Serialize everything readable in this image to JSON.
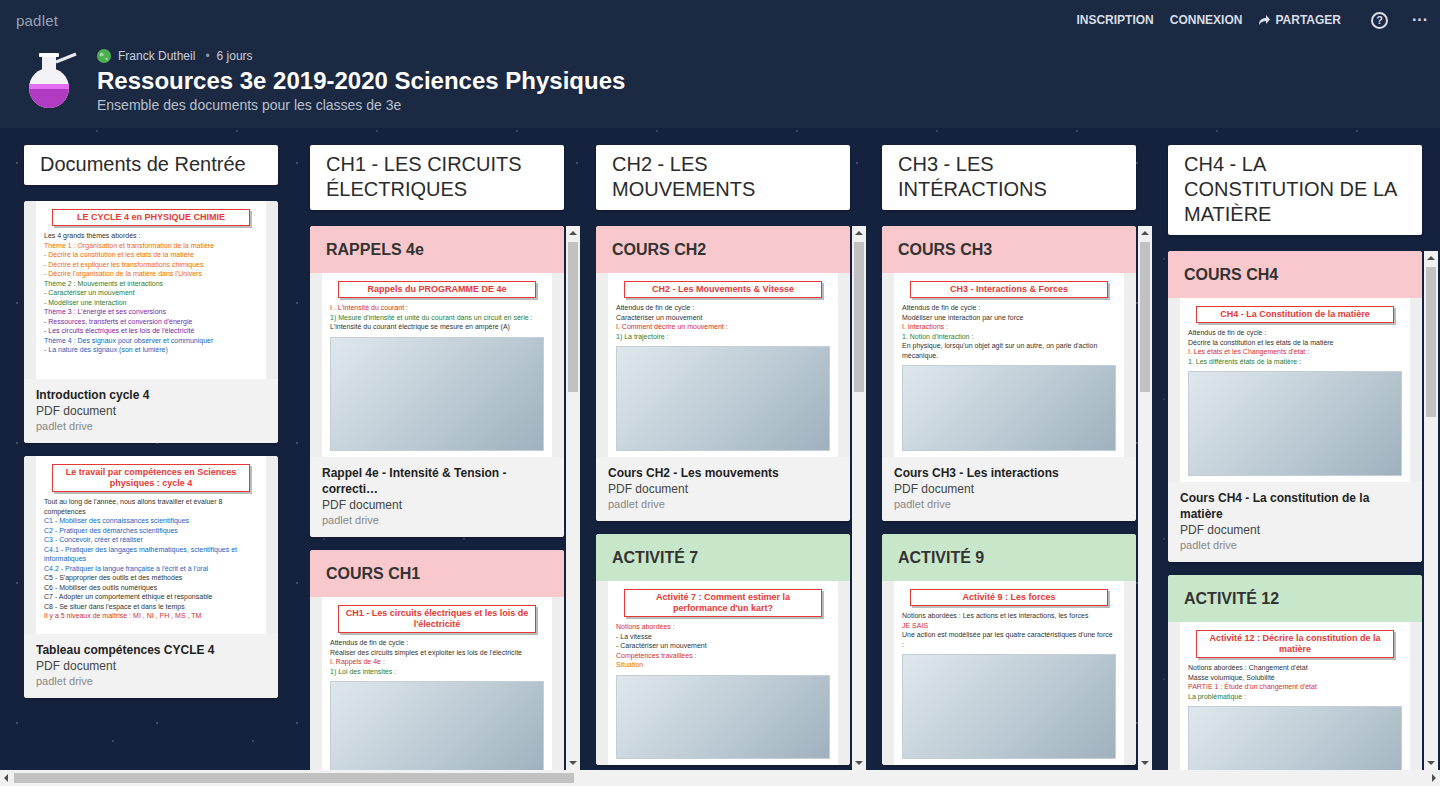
{
  "brand": "padlet",
  "nav": [
    "INSCRIPTION",
    "CONNEXION"
  ],
  "share": "PARTAGER",
  "help": "?",
  "more": "···",
  "board": {
    "author": "Franck Dutheil",
    "separator": "•",
    "age": "6 jours",
    "title": "Ressources 3e 2019-2020 Sciences Physiques",
    "subtitle": "Ensemble des documents pour les classes de 3e"
  },
  "columns": [
    {
      "title": "Documents de Rentrée",
      "scrollable": false,
      "cards": [
        {
          "thumb": {
            "title": "LE CYCLE 4 en PHYSIQUE CHIMIE",
            "figure": false,
            "lines": [
              {
                "text": "Les 4 grands thèmes abordés :",
                "color": "#333333"
              },
              {
                "text": "Thème 1 : Organisation et transformation de la matière",
                "color": "#ef6c00"
              },
              {
                "text": "- Décrire la constitution et les états de la matière",
                "color": "#ef6c00"
              },
              {
                "text": "- Décrire et expliquer les transformations chimiques",
                "color": "#ef6c00"
              },
              {
                "text": "- Décrire l'organisation de la matière dans l'Univers",
                "color": "#ef6c00"
              },
              {
                "text": "Thème 2 : Mouvements et interactions",
                "color": "#2e7d32"
              },
              {
                "text": "- Caractériser un mouvement",
                "color": "#2e7d32"
              },
              {
                "text": "- Modéliser une interaction",
                "color": "#2e7d32"
              },
              {
                "text": "Thème 3 : L'énergie et ses conversions",
                "color": "#7b1fa2"
              },
              {
                "text": "- Ressources, transferts et conversion d'énergie",
                "color": "#7b1fa2"
              },
              {
                "text": "- Les circuits électriques et les lois de l'électricité",
                "color": "#7b1fa2"
              },
              {
                "text": "Thème 4 : Des signaux pour observer et communiquer",
                "color": "#1565c0"
              },
              {
                "text": "- La nature des signaux (son et lumière)",
                "color": "#1565c0"
              }
            ]
          },
          "title": "Introduction cycle 4",
          "type": "PDF document",
          "source": "padlet drive"
        },
        {
          "thumb": {
            "title": "Le travail par compétences en Sciences physiques : cycle 4",
            "figure": false,
            "lines": [
              {
                "text": "Tout au long de l'année, nous allons travailler et évaluer 8 compétences",
                "color": "#333333"
              },
              {
                "text": "C1 - Mobiliser des connaissances scientifiques",
                "color": "#1565c0"
              },
              {
                "text": "C2 - Pratiquer des démarches scientifiques",
                "color": "#1565c0"
              },
              {
                "text": "C3 - Concevoir, créer et réaliser",
                "color": "#1565c0"
              },
              {
                "text": "C4.1 - Pratiquer des langages mathématiques, scientifiques et informatiques",
                "color": "#1565c0"
              },
              {
                "text": "C4.2 - Pratiquer la langue française à l'écrit et à l'oral",
                "color": "#1565c0"
              },
              {
                "text": "C5 - S'approprier des outils et des méthodes",
                "color": "#333333"
              },
              {
                "text": "C6 - Mobiliser des outils numériques",
                "color": "#333333"
              },
              {
                "text": "C7 - Adopter un comportement éthique et responsable",
                "color": "#333333"
              },
              {
                "text": "C8 - Se situer dans l'espace et dans le temps",
                "color": "#333333"
              },
              {
                "text": "Il y a 5 niveaux de maîtrise : MI , NI , PH , MS , TM",
                "color": "#d32f2f"
              }
            ]
          },
          "title": "Tableau compétences CYCLE 4",
          "type": "PDF document",
          "source": "padlet drive"
        }
      ]
    },
    {
      "title": "CH1 - LES CIRCUITS ÉLECTRIQUES",
      "scrollable": true,
      "cards": [
        {
          "header": "RAPPELS 4e",
          "color": "#f8c8cc",
          "thumb": {
            "title": "Rappels du PROGRAMME DE 4e",
            "figure": true,
            "lines": [
              {
                "text": "I . L'intensité du courant :",
                "color": "#d32f2f"
              },
              {
                "text": "1) Mesure d'intensité et unité du courant dans un circuit en série :",
                "color": "#2e7d32"
              },
              {
                "text": "L'intensité du courant électrique se mesure en ampère (A)",
                "color": "#333333"
              }
            ]
          },
          "title": "Rappel 4e - Intensité & Tension - correcti…",
          "type": "PDF document",
          "source": "padlet drive"
        },
        {
          "header": "COURS CH1",
          "color": "#f8c8cc",
          "thumb": {
            "title": "CH1 - Les circuits électriques et les lois de l'électricité",
            "figure": true,
            "lines": [
              {
                "text": "Attendus de fin de cycle :",
                "color": "#333333"
              },
              {
                "text": "Réaliser des circuits simples et exploiter les lois de l'électricité",
                "color": "#333333"
              },
              {
                "text": "I. Rappels de 4e :",
                "color": "#d32f2f"
              },
              {
                "text": "1) Loi des intensités :",
                "color": "#2e7d32"
              }
            ]
          }
        }
      ]
    },
    {
      "title": "CH2 - LES MOUVEMENTS",
      "scrollable": true,
      "cards": [
        {
          "header": "COURS CH2",
          "color": "#f8c8cc",
          "thumb": {
            "title": "CH2 - Les Mouvements & Vitesse",
            "figure": true,
            "lines": [
              {
                "text": "Attendus de fin de cycle :",
                "color": "#333333"
              },
              {
                "text": "Caractériser un mouvement",
                "color": "#333333"
              },
              {
                "text": "I. Comment décrire un mouvement :",
                "color": "#d32f2f"
              },
              {
                "text": "1) La trajectoire :",
                "color": "#2e7d32"
              }
            ]
          },
          "title": "Cours CH2 - Les mouvements",
          "type": "PDF document",
          "source": "padlet drive"
        },
        {
          "header": "ACTIVITÉ 7",
          "color": "#c8e6c9",
          "thumb": {
            "title": "Activité 7 : Comment estimer la performance d'un kart?",
            "figure": true,
            "lines": [
              {
                "text": "Notions abordées :",
                "color": "#d32f2f"
              },
              {
                "text": "- La vitesse",
                "color": "#333333"
              },
              {
                "text": "- Caractériser un mouvement",
                "color": "#333333"
              },
              {
                "text": "Compétences travaillées :",
                "color": "#d32f2f"
              },
              {
                "text": "Situation",
                "color": "#ef6c00"
              }
            ]
          }
        }
      ]
    },
    {
      "title": "CH3 - LES INTÉRACTIONS",
      "scrollable": true,
      "cards": [
        {
          "header": "COURS CH3",
          "color": "#f8c8cc",
          "thumb": {
            "title": "CH3 - Interactions & Forces",
            "figure": true,
            "lines": [
              {
                "text": "Attendus de fin de cycle :",
                "color": "#333333"
              },
              {
                "text": "Modéliser une interaction par une force",
                "color": "#333333"
              },
              {
                "text": "I. Interactions :",
                "color": "#d32f2f"
              },
              {
                "text": "1. Notion d'interaction :",
                "color": "#2e7d32"
              },
              {
                "text": "En physique, lorsqu'un objet agit sur un autre, on parle d'action mécanique.",
                "color": "#333333"
              }
            ]
          },
          "title": "Cours CH3 - Les interactions",
          "type": "PDF document",
          "source": "padlet drive"
        },
        {
          "header": "ACTIVITÉ 9",
          "color": "#c8e6c9",
          "thumb": {
            "title": "Activité 9 : Les forces",
            "figure": true,
            "lines": [
              {
                "text": "Notions abordées : Les actions et les interactions, les forces",
                "color": "#333333"
              },
              {
                "text": "JE SAIS",
                "color": "#d32f2f"
              },
              {
                "text": "Une action est modélisée par les quatre caractéristiques d'une force :",
                "color": "#333333"
              }
            ]
          }
        }
      ]
    },
    {
      "title": "CH4 - LA CONSTITUTION DE LA MATIÈRE",
      "scrollable": true,
      "cards": [
        {
          "header": "COURS CH4",
          "color": "#f8c8cc",
          "thumb": {
            "title": "CH4 - La Constitution de la matière",
            "figure": true,
            "lines": [
              {
                "text": "Attendus de fin de cycle :",
                "color": "#333333"
              },
              {
                "text": "Décrire la constitution et les états de la matière",
                "color": "#333333"
              },
              {
                "text": "I. Les états et les Changements d'état :",
                "color": "#d32f2f"
              },
              {
                "text": "1. Les différents états de la matière :",
                "color": "#2e7d32"
              }
            ]
          },
          "title": "Cours CH4 - La constitution de la matière",
          "type": "PDF document",
          "source": "padlet drive"
        },
        {
          "header": "ACTIVITÉ 12",
          "color": "#c8e6c9",
          "thumb": {
            "title": "Activité 12 : Décrire la constitution de la matière",
            "figure": true,
            "lines": [
              {
                "text": "Notions abordées : Changement d'état",
                "color": "#333333"
              },
              {
                "text": "Masse volumique, Solubilité",
                "color": "#333333"
              },
              {
                "text": "PARTIE 1 : Étude d'un changement d'état",
                "color": "#d32f2f"
              },
              {
                "text": "La problématique :",
                "color": "#2e7d32"
              }
            ]
          }
        }
      ]
    }
  ]
}
